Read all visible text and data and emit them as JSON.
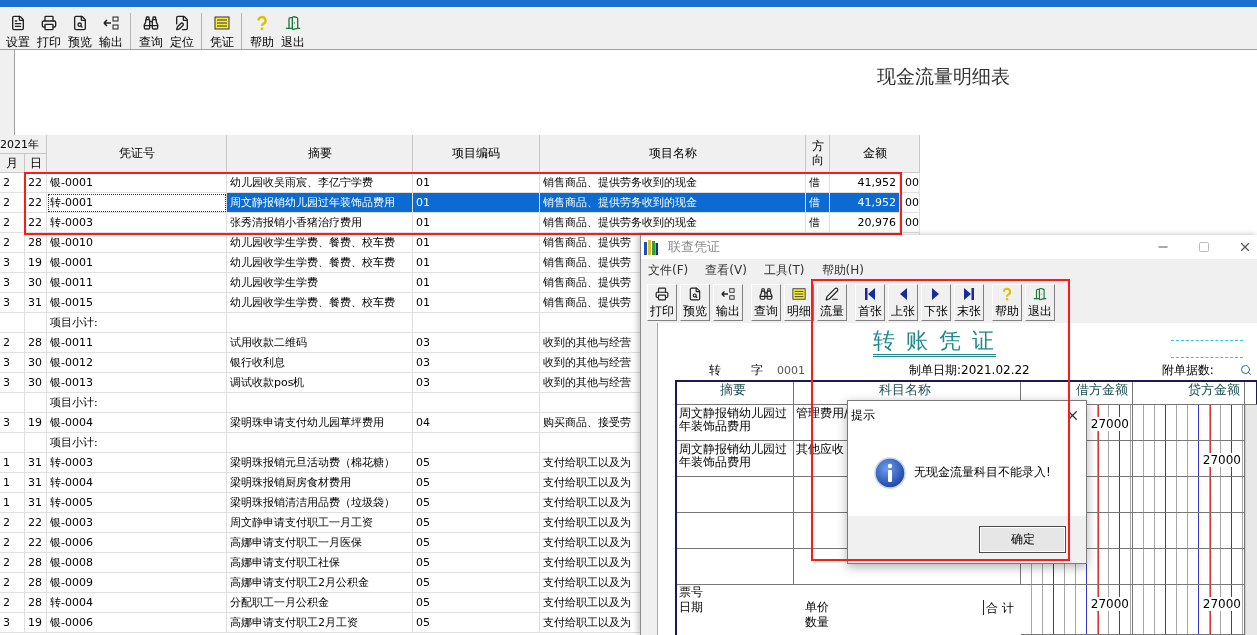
{
  "toolbar": [
    [
      {
        "label": "设置",
        "kind": "settings"
      },
      {
        "label": "打印",
        "kind": "print"
      },
      {
        "label": "预览",
        "kind": "preview"
      },
      {
        "label": "输出",
        "kind": "export"
      }
    ],
    [
      {
        "label": "查询",
        "kind": "query"
      },
      {
        "label": "定位",
        "kind": "locate"
      }
    ],
    [
      {
        "label": "凭证",
        "kind": "voucher"
      }
    ],
    [
      {
        "label": "帮助",
        "kind": "help"
      },
      {
        "label": "退出",
        "kind": "exit"
      }
    ]
  ],
  "report_title": "现金流量明细表",
  "main_table": {
    "year": "2021年",
    "columns": [
      "月",
      "日",
      "凭证号",
      "摘要",
      "项目编码",
      "项目名称",
      "方向",
      "金额"
    ],
    "rows": [
      {
        "kind": "entry",
        "selected": false,
        "month": "2",
        "day": "22",
        "voucher_no": "银-0001",
        "summary": "幼儿园收吴雨宸、李亿宁学费",
        "code": "01",
        "project_name": "销售商品、提供劳务收到的现金",
        "direction": "借",
        "amount": "41,952",
        "cents": "00"
      },
      {
        "kind": "entry",
        "selected": true,
        "month": "2",
        "day": "22",
        "voucher_no": "转-0001",
        "summary": "周文静报销幼儿园过年装饰品费用",
        "code": "01",
        "project_name": "销售商品、提供劳务收到的现金",
        "direction": "借",
        "amount": "41,952",
        "cents": "00"
      },
      {
        "kind": "entry",
        "selected": false,
        "month": "2",
        "day": "22",
        "voucher_no": "转-0003",
        "summary": "张秀清报销小香猪治疗费用",
        "code": "01",
        "project_name": "销售商品、提供劳务收到的现金",
        "direction": "借",
        "amount": "20,976",
        "cents": "00"
      },
      {
        "kind": "entry",
        "selected": false,
        "month": "2",
        "day": "28",
        "voucher_no": "银-0010",
        "summary": "幼儿园收学生学费、餐费、校车费",
        "code": "01",
        "project_name": "销售商品、提供劳"
      },
      {
        "kind": "entry",
        "selected": false,
        "month": "3",
        "day": "19",
        "voucher_no": "银-0001",
        "summary": "幼儿园收学生学费、餐费、校车费",
        "code": "01",
        "project_name": "销售商品、提供劳"
      },
      {
        "kind": "entry",
        "selected": false,
        "month": "3",
        "day": "30",
        "voucher_no": "银-0011",
        "summary": "幼儿园收学生学费",
        "code": "01",
        "project_name": "销售商品、提供劳"
      },
      {
        "kind": "entry",
        "selected": false,
        "month": "3",
        "day": "31",
        "voucher_no": "银-0015",
        "summary": "幼儿园收学生学费、餐费、校车费",
        "code": "01",
        "project_name": "销售商品、提供劳"
      },
      {
        "kind": "subtotal",
        "selected": false,
        "label": "项目小计:"
      },
      {
        "kind": "entry",
        "selected": false,
        "month": "2",
        "day": "28",
        "voucher_no": "银-0011",
        "summary": "试用收款二维码",
        "code": "03",
        "project_name": "收到的其他与经营"
      },
      {
        "kind": "entry",
        "selected": false,
        "month": "3",
        "day": "30",
        "voucher_no": "银-0012",
        "summary": "银行收利息",
        "code": "03",
        "project_name": "收到的其他与经营"
      },
      {
        "kind": "entry",
        "selected": false,
        "month": "3",
        "day": "30",
        "voucher_no": "银-0013",
        "summary": "调试收款pos机",
        "code": "03",
        "project_name": "收到的其他与经营"
      },
      {
        "kind": "subtotal",
        "selected": false,
        "label": "项目小计:"
      },
      {
        "kind": "entry",
        "selected": false,
        "month": "3",
        "day": "19",
        "voucher_no": "银-0004",
        "summary": "梁明珠申请支付幼儿园草坪费用",
        "code": "04",
        "project_name": "购买商品、接受劳"
      },
      {
        "kind": "subtotal",
        "selected": false,
        "label": "项目小计:"
      },
      {
        "kind": "entry",
        "selected": false,
        "month": "1",
        "day": "31",
        "voucher_no": "转-0003",
        "summary": "梁明珠报销元旦活动费（棉花糖）",
        "code": "05",
        "project_name": "支付给职工以及为"
      },
      {
        "kind": "entry",
        "selected": false,
        "month": "1",
        "day": "31",
        "voucher_no": "转-0004",
        "summary": "梁明珠报销厨房食材费用",
        "code": "05",
        "project_name": "支付给职工以及为"
      },
      {
        "kind": "entry",
        "selected": false,
        "month": "1",
        "day": "31",
        "voucher_no": "转-0005",
        "summary": "梁明珠报销清洁用品费（垃圾袋）",
        "code": "05",
        "project_name": "支付给职工以及为"
      },
      {
        "kind": "entry",
        "selected": false,
        "month": "2",
        "day": "22",
        "voucher_no": "银-0003",
        "summary": "周文静申请支付职工一月工资",
        "code": "05",
        "project_name": "支付给职工以及为"
      },
      {
        "kind": "entry",
        "selected": false,
        "month": "2",
        "day": "22",
        "voucher_no": "银-0006",
        "summary": "高娜申请支付职工一月医保",
        "code": "05",
        "project_name": "支付给职工以及为"
      },
      {
        "kind": "entry",
        "selected": false,
        "month": "2",
        "day": "28",
        "voucher_no": "银-0008",
        "summary": "高娜申请支付职工社保",
        "code": "05",
        "project_name": "支付给职工以及为"
      },
      {
        "kind": "entry",
        "selected": false,
        "month": "2",
        "day": "28",
        "voucher_no": "银-0009",
        "summary": "高娜申请支付职工2月公积金",
        "code": "05",
        "project_name": "支付给职工以及为"
      },
      {
        "kind": "entry",
        "selected": false,
        "month": "2",
        "day": "28",
        "voucher_no": "转-0004",
        "summary": "分配职工一月公积金",
        "code": "05",
        "project_name": "支付给职工以及为"
      },
      {
        "kind": "entry",
        "selected": false,
        "month": "3",
        "day": "19",
        "voucher_no": "银-0006",
        "summary": "高娜申请支付职工2月工资",
        "code": "05",
        "project_name": "支付给职工以及为"
      }
    ]
  },
  "voucher_window": {
    "title": "联查凭证",
    "menu": [
      "文件(F)",
      "查看(V)",
      "工具(T)",
      "帮助(H)"
    ],
    "toolbar": [
      [
        {
          "label": "打印",
          "kind": "print"
        },
        {
          "label": "预览",
          "kind": "preview"
        },
        {
          "label": "输出",
          "kind": "export"
        }
      ],
      [
        {
          "label": "查询",
          "kind": "query"
        },
        {
          "label": "明细",
          "kind": "detail"
        },
        {
          "label": "流量",
          "kind": "flow"
        }
      ],
      [
        {
          "label": "首张",
          "kind": "first"
        },
        {
          "label": "上张",
          "kind": "prev"
        },
        {
          "label": "下张",
          "kind": "next"
        },
        {
          "label": "末张",
          "kind": "last"
        }
      ],
      [
        {
          "label": "帮助",
          "kind": "help"
        },
        {
          "label": "退出",
          "kind": "exit"
        }
      ]
    ],
    "voucher": {
      "title": "转 账 凭 证",
      "type": "转",
      "type_suffix": "字",
      "number": "0001",
      "date": "制单日期:2021.02.22",
      "attachments": "附单据数:",
      "columns": [
        "摘要",
        "科目名称",
        "借方金额",
        "贷方金额"
      ],
      "entries": [
        {
          "summary": "周文静报销幼儿园过年装饰品费用",
          "account": "管理费用/",
          "debit": "27000"
        },
        {
          "summary": "周文静报销幼儿园过年装饰品费用",
          "account": "其他应收",
          "credit": "27000"
        }
      ],
      "footer": {
        "ticket": "票号",
        "date": "日期",
        "price": "单价",
        "quantity": "数量",
        "total_label": "合 计",
        "debit_total": "27000",
        "credit_total": "27000"
      }
    }
  },
  "dialog": {
    "title": "提示",
    "message": "无现金流量科目不能录入!",
    "button": "确定"
  }
}
